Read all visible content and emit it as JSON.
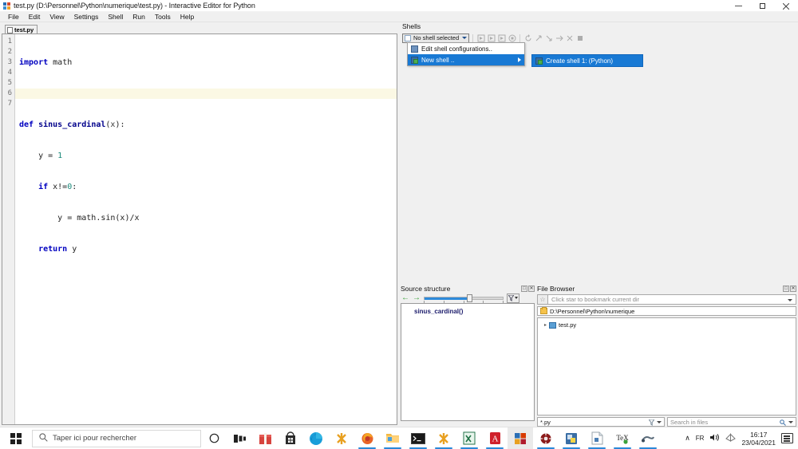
{
  "window": {
    "title": "test.py (D:\\Personnel\\Python\\numerique\\test.py) - Interactive Editor for Python",
    "minimize_label": "–",
    "maximize_label": "❐",
    "close_label": "✕"
  },
  "menubar": {
    "items": [
      {
        "label": "File"
      },
      {
        "label": "Edit"
      },
      {
        "label": "View"
      },
      {
        "label": "Settings"
      },
      {
        "label": "Shell"
      },
      {
        "label": "Run"
      },
      {
        "label": "Tools"
      },
      {
        "label": "Help"
      }
    ]
  },
  "editor": {
    "tab_label": "test.py",
    "current_line": 2,
    "line_numbers": [
      "1",
      "2",
      "3",
      "4",
      "5",
      "6",
      "7"
    ],
    "code_lines": [
      "import math",
      "",
      "def sinus_cardinal(x):",
      "    y = 1",
      "    if x!=0:",
      "        y = math.sin(x)/x",
      "    return y"
    ]
  },
  "shells": {
    "panel_title": "Shells",
    "combo_value": "No shell selected",
    "toolbar_icon_names": [
      "run-file-icon",
      "run-selection-icon",
      "run-cell-icon",
      "interrupt-icon",
      "restart-icon",
      "debug-step-icon",
      "debug-stepin-icon",
      "debug-stepover-icon",
      "close-shell-icon",
      "stop-icon"
    ],
    "menu": {
      "items": [
        {
          "label": "Edit shell configurations..",
          "icon": "config-icon",
          "selected": false,
          "has_submenu": false
        },
        {
          "label": "New shell ..",
          "icon": "shell-icon",
          "selected": true,
          "has_submenu": true
        }
      ],
      "submenu": [
        {
          "label": "Create shell 1: (Python)",
          "icon": "shell-icon",
          "selected": true
        }
      ]
    }
  },
  "source_structure": {
    "panel_title": "Source structure",
    "back_arrow": "←",
    "forward_arrow": "→",
    "slider_value": 55,
    "slider_min": 0,
    "slider_max": 100,
    "items": [
      {
        "label": "sinus_cardinal()"
      }
    ],
    "float_label": "□",
    "close_label": "✕"
  },
  "file_browser": {
    "panel_title": "File Browser",
    "bookmark_placeholder": "Click star to bookmark current dir",
    "current_path": "D:\\Personnel\\Python\\numerique",
    "tree": [
      {
        "label": "test.py",
        "icon": "python-file-icon",
        "expander": "▸"
      }
    ],
    "filter_value": "*.py",
    "search_placeholder": "Search in files",
    "float_label": "□",
    "close_label": "✕"
  },
  "taskbar": {
    "search_placeholder": "Taper ici pour rechercher",
    "cortana_label": "○",
    "taskview_label": "⧉",
    "pinned": [
      {
        "name": "gift-icon",
        "glyph": "🎁",
        "color": "#d7443e",
        "active": false
      },
      {
        "name": "microsoft-store-icon",
        "glyph": "🛍",
        "color": "#2b6fb5",
        "active": false
      },
      {
        "name": "edge-browser-icon",
        "glyph": "◔",
        "color": "#1a9ed9",
        "active": false
      },
      {
        "name": "pyzo-icon",
        "glyph": "✳",
        "color": "#e8a020",
        "active": false
      },
      {
        "name": "firefox-icon",
        "glyph": "◉",
        "color": "#e8632a",
        "active": true
      },
      {
        "name": "file-explorer-icon",
        "glyph": "🗀",
        "color": "#f4b942",
        "active": true
      },
      {
        "name": "terminal-icon",
        "glyph": "■",
        "color": "#1a1a1a",
        "active": true
      },
      {
        "name": "pyzo-editor-icon",
        "glyph": "✳",
        "color": "#e8a020",
        "active": true
      },
      {
        "name": "excel-icon",
        "glyph": "X",
        "color": "#1d7044",
        "active": true
      },
      {
        "name": "acrobat-reader-icon",
        "glyph": "A",
        "color": "#d0202b",
        "active": true
      },
      {
        "name": "office-icon",
        "glyph": "▦",
        "color": "#d83b01",
        "active": true
      },
      {
        "name": "settings-wheel-icon",
        "glyph": "☸",
        "color": "#8b1a1a",
        "active": true
      },
      {
        "name": "python-idle-icon",
        "glyph": "◧",
        "color": "#3a6ea5",
        "active": true
      },
      {
        "name": "python-doc-icon",
        "glyph": "◨",
        "color": "#9aa5ad",
        "active": true
      },
      {
        "name": "tex-editor-icon",
        "glyph": "T",
        "color": "#222222",
        "active": true
      },
      {
        "name": "scilab-icon",
        "glyph": "◆",
        "color": "#5a6b7a",
        "active": true
      }
    ],
    "tray": {
      "chevron": "∧",
      "language": "FR",
      "volume_icon": "volume-icon",
      "network_icon": "wifi-icon",
      "time": "16:17",
      "date": "23/04/2021",
      "notifications_icon": "action-center-icon"
    }
  }
}
